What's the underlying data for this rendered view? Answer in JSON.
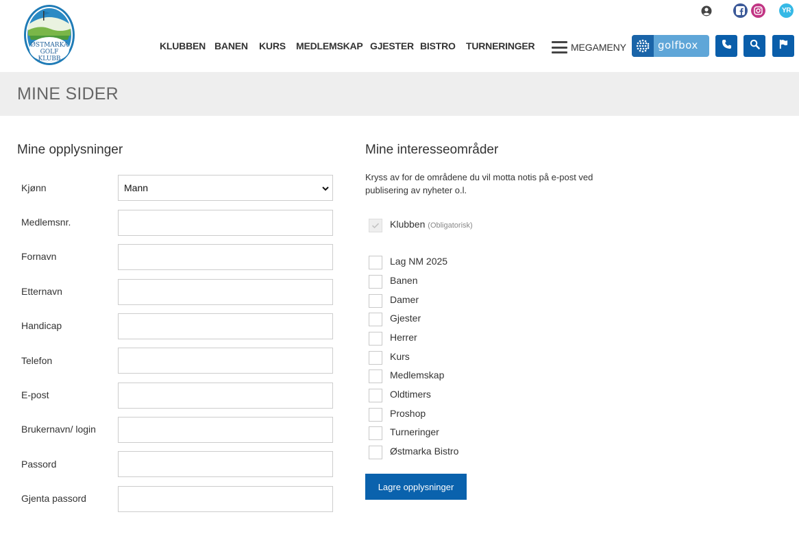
{
  "header": {
    "logo_text": "ØSTMARKA GOLF KLUBB",
    "social": {
      "yr_label": "YR"
    },
    "nav": [
      "KLUBBEN",
      "BANEN",
      "KURS",
      "MEDLEMSKAP",
      "GJESTER",
      "BISTRO",
      "TURNERINGER"
    ],
    "megameny_label": "MEGAMENY",
    "golfbox_label": "golfbox",
    "icons": [
      "user-icon",
      "facebook-icon",
      "instagram-icon",
      "yr-icon",
      "phone-icon",
      "search-icon",
      "flag-icon"
    ]
  },
  "page_title": "MINE SIDER",
  "left": {
    "title": "Mine opplysninger",
    "gender": {
      "label": "Kjønn",
      "value": "Mann"
    },
    "fields": [
      {
        "label": "Medlemsnr.",
        "value": ""
      },
      {
        "label": "Fornavn",
        "value": ""
      },
      {
        "label": "Etternavn",
        "value": ""
      },
      {
        "label": "Handicap",
        "value": ""
      },
      {
        "label": "Telefon",
        "value": ""
      },
      {
        "label": "E-post",
        "value": ""
      },
      {
        "label": "Brukernavn/ login",
        "value": ""
      },
      {
        "label": "Passord",
        "value": ""
      },
      {
        "label": "Gjenta passord",
        "value": ""
      }
    ]
  },
  "right": {
    "title": "Mine interesseområder",
    "description": "Kryss av for de områdene du vil motta notis på e-post ved publisering av nyheter o.l.",
    "required": {
      "label": "Klubben",
      "note": "(Obligatorisk)",
      "checked": true
    },
    "options": [
      {
        "label": "Lag NM 2025",
        "checked": false
      },
      {
        "label": "Banen",
        "checked": false
      },
      {
        "label": "Damer",
        "checked": false
      },
      {
        "label": "Gjester",
        "checked": false
      },
      {
        "label": "Herrer",
        "checked": false
      },
      {
        "label": "Kurs",
        "checked": false
      },
      {
        "label": "Medlemskap",
        "checked": false
      },
      {
        "label": "Oldtimers",
        "checked": false
      },
      {
        "label": "Proshop",
        "checked": false
      },
      {
        "label": "Turneringer",
        "checked": false
      },
      {
        "label": "Østmarka Bistro",
        "checked": false
      }
    ],
    "save_label": "Lagre opplysninger"
  },
  "colors": {
    "primary": "#0a62ad",
    "golfbox": "#5fa6d8",
    "band": "#eeeeee"
  }
}
